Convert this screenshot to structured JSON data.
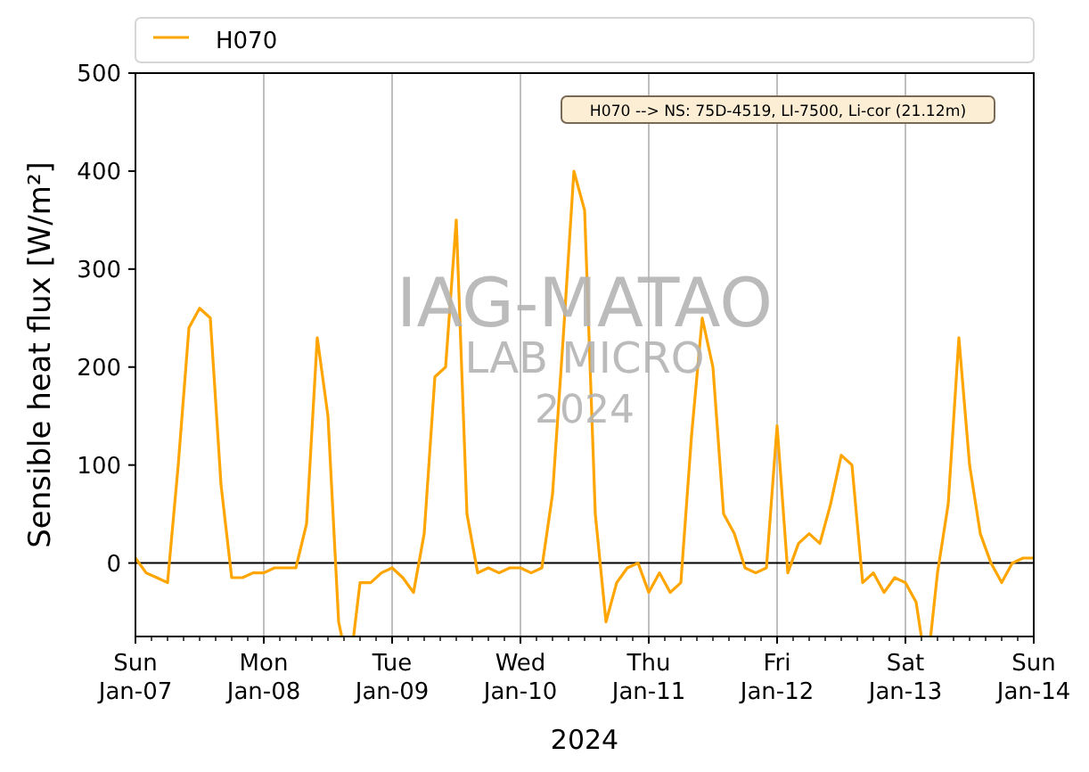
{
  "chart_data": {
    "type": "line",
    "grid": "x",
    "xlabel": "2024",
    "ylabel": "Sensible heat flux [W/m²]",
    "x": [
      "2024-01-07T00:00",
      "2024-01-07T02:00",
      "2024-01-07T04:00",
      "2024-01-07T06:00",
      "2024-01-07T08:00",
      "2024-01-07T10:00",
      "2024-01-07T12:00",
      "2024-01-07T14:00",
      "2024-01-07T16:00",
      "2024-01-07T18:00",
      "2024-01-07T20:00",
      "2024-01-07T22:00",
      "2024-01-08T00:00",
      "2024-01-08T02:00",
      "2024-01-08T04:00",
      "2024-01-08T06:00",
      "2024-01-08T08:00",
      "2024-01-08T10:00",
      "2024-01-08T12:00",
      "2024-01-08T14:00",
      "2024-01-08T16:00",
      "2024-01-08T18:00",
      "2024-01-08T20:00",
      "2024-01-08T22:00",
      "2024-01-09T00:00",
      "2024-01-09T02:00",
      "2024-01-09T04:00",
      "2024-01-09T06:00",
      "2024-01-09T08:00",
      "2024-01-09T10:00",
      "2024-01-09T12:00",
      "2024-01-09T14:00",
      "2024-01-09T16:00",
      "2024-01-09T18:00",
      "2024-01-09T20:00",
      "2024-01-09T22:00",
      "2024-01-10T00:00",
      "2024-01-10T02:00",
      "2024-01-10T04:00",
      "2024-01-10T06:00",
      "2024-01-10T08:00",
      "2024-01-10T10:00",
      "2024-01-10T12:00",
      "2024-01-10T14:00",
      "2024-01-10T16:00",
      "2024-01-10T18:00",
      "2024-01-10T20:00",
      "2024-01-10T22:00",
      "2024-01-11T00:00",
      "2024-01-11T02:00",
      "2024-01-11T04:00",
      "2024-01-11T06:00",
      "2024-01-11T08:00",
      "2024-01-11T10:00",
      "2024-01-11T12:00",
      "2024-01-11T14:00",
      "2024-01-11T16:00",
      "2024-01-11T18:00",
      "2024-01-11T20:00",
      "2024-01-11T22:00",
      "2024-01-12T00:00",
      "2024-01-12T02:00",
      "2024-01-12T04:00",
      "2024-01-12T06:00",
      "2024-01-12T08:00",
      "2024-01-12T10:00",
      "2024-01-12T12:00",
      "2024-01-12T14:00",
      "2024-01-12T16:00",
      "2024-01-12T18:00",
      "2024-01-12T20:00",
      "2024-01-12T22:00",
      "2024-01-13T00:00",
      "2024-01-13T02:00",
      "2024-01-13T04:00",
      "2024-01-13T06:00",
      "2024-01-13T08:00",
      "2024-01-13T10:00",
      "2024-01-13T12:00",
      "2024-01-13T14:00",
      "2024-01-13T16:00",
      "2024-01-13T18:00",
      "2024-01-13T20:00",
      "2024-01-13T22:00",
      "2024-01-14T00:00"
    ],
    "series": [
      {
        "name": "H070",
        "color": "#ffa500",
        "values": [
          5,
          -10,
          -15,
          -20,
          100,
          240,
          260,
          250,
          80,
          -15,
          -15,
          -10,
          -10,
          -5,
          -5,
          -5,
          40,
          230,
          150,
          -60,
          null,
          -20,
          -20,
          -10,
          -5,
          -15,
          -30,
          30,
          190,
          200,
          350,
          50,
          -10,
          -5,
          -10,
          -5,
          -5,
          -10,
          -5,
          70,
          230,
          400,
          360,
          50,
          -60,
          -20,
          -5,
          0,
          -30,
          -10,
          -30,
          -20,
          130,
          250,
          200,
          50,
          30,
          -5,
          -10,
          -5,
          140,
          -10,
          20,
          30,
          20,
          60,
          110,
          100,
          -20,
          -10,
          -30,
          -15,
          -20,
          -40,
          null,
          -10,
          60,
          230,
          100,
          30,
          0,
          -20,
          0,
          5,
          5
        ]
      }
    ],
    "xlim": [
      "2024-01-07T00:00",
      "2024-01-14T00:00"
    ],
    "ylim": [
      -75,
      500
    ],
    "xticks": [
      {
        "value": "2024-01-07T00:00",
        "label": "Sun Jan-07"
      },
      {
        "value": "2024-01-08T00:00",
        "label": "Mon Jan-08"
      },
      {
        "value": "2024-01-09T00:00",
        "label": "Tue Jan-09"
      },
      {
        "value": "2024-01-10T00:00",
        "label": "Wed Jan-10"
      },
      {
        "value": "2024-01-11T00:00",
        "label": "Thu Jan-11"
      },
      {
        "value": "2024-01-12T00:00",
        "label": "Fri Jan-12"
      },
      {
        "value": "2024-01-13T00:00",
        "label": "Sat Jan-13"
      },
      {
        "value": "2024-01-14T00:00",
        "label": "Sun Jan-14"
      }
    ],
    "yticks": [
      0,
      100,
      200,
      300,
      400,
      500
    ],
    "annotations": [
      "H070 --> NS: 75D-4519, LI-7500, Li-cor (21.12m)"
    ]
  },
  "watermark": [
    "IAG-MATAO",
    "LAB MICRO",
    "2024"
  ]
}
